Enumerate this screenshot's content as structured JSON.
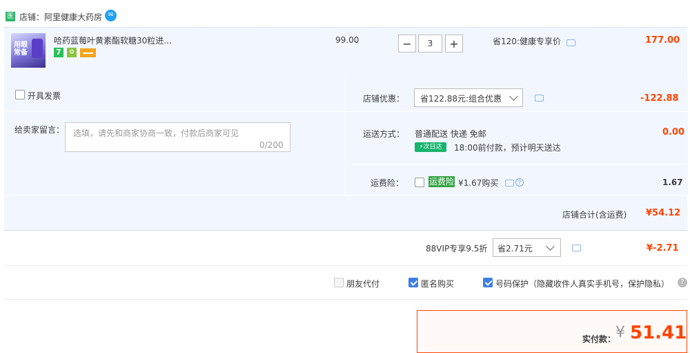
{
  "shop": {
    "badge": "医",
    "name": "店铺：阿里健康大药房"
  },
  "item": {
    "thumb_text": "用眼常备",
    "title": "哈药蓝莓叶黄素酯软糖30粒进...",
    "tag_seven": "7",
    "unit_price": "99.00",
    "quantity": "3",
    "minus": "−",
    "plus": "+",
    "promo": "省120:健康专享价",
    "total": "177.00"
  },
  "invoice": {
    "label": "开具发票"
  },
  "memo": {
    "label": "给卖家留言：",
    "placeholder": "选填，请先和商家协商一致，付款后商家可见",
    "count": "0/200"
  },
  "discount": {
    "label": "店铺优惠：",
    "selected": "省122.88元:组合优惠",
    "amount": "-122.88"
  },
  "shipping": {
    "label": "运送方式：",
    "method": "普通配送 快递 免邮",
    "badge": "⚡次日达",
    "eta": "18:00前付款，预计明天送达",
    "fee": "0.00"
  },
  "insurance": {
    "label": "运费险：",
    "badge": "运费险",
    "price": "¥1.67购买",
    "amount": "1.67"
  },
  "shop_total": {
    "label": "店铺合计(含运费)",
    "amount": "¥54.12"
  },
  "vip": {
    "label": "88VIP专享9.5折",
    "selected": "省2.71元",
    "amount": "¥-2.71"
  },
  "options": {
    "friend_pay": "朋友代付",
    "anonymous": "匿名购买",
    "phone_protect": "号码保护（隐藏收件人真实手机号，保护隐私）",
    "help": "?"
  },
  "payment": {
    "label": "实付款：",
    "currency": "¥",
    "amount": "51.41"
  },
  "icons": {
    "ww": "✉",
    "android": "⚙",
    "help": "?"
  }
}
